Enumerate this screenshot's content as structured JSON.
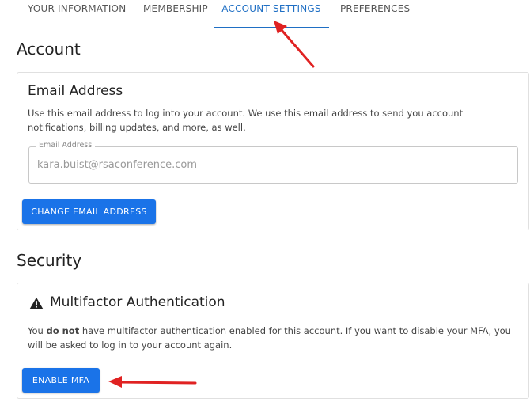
{
  "tabs": [
    {
      "label": "YOUR INFORMATION",
      "active": false
    },
    {
      "label": "MEMBERSHIP",
      "active": false
    },
    {
      "label": "ACCOUNT SETTINGS",
      "active": true
    },
    {
      "label": "PREFERENCES",
      "active": false
    }
  ],
  "account": {
    "heading": "Account",
    "email_card": {
      "title": "Email Address",
      "description": "Use this email address to log into your account. We use this email address to send you account notifications, billing updates, and more, as well.",
      "field_label": "Email Address",
      "field_value": "kara.buist@rsaconference.com",
      "button_label": "CHANGE EMAIL ADDRESS"
    }
  },
  "security": {
    "heading": "Security",
    "mfa_card": {
      "icon": "warning-icon",
      "title": "Multifactor Authentication",
      "description_prefix": "You ",
      "description_bold": "do not",
      "description_suffix": " have multifactor authentication enabled for this account. If you want to disable your MFA, you will be asked to log in to your account again.",
      "button_label": "ENABLE MFA"
    }
  },
  "colors": {
    "accent": "#1f6fc4",
    "button": "#1a73e8",
    "annotation": "#e02222"
  }
}
